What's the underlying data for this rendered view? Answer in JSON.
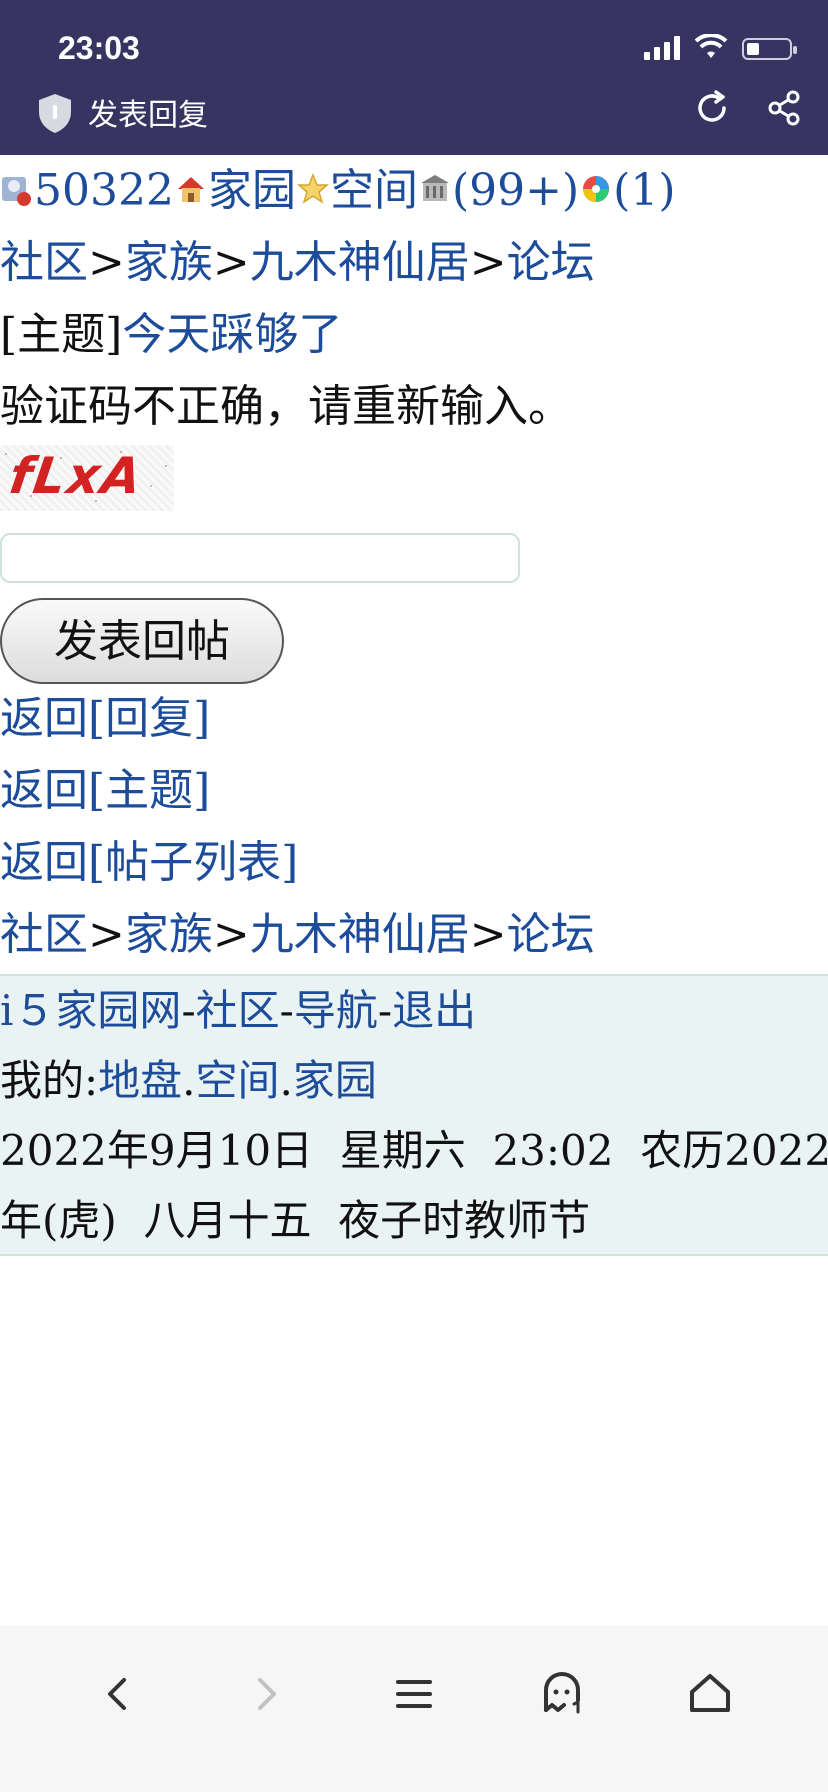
{
  "status": {
    "time": "23:03",
    "battery_level": 0.3
  },
  "topbar": {
    "title": "发表回复",
    "icons": {
      "shield": "shield-icon",
      "refresh": "refresh-icon",
      "share": "share-icon"
    }
  },
  "userbar": {
    "user_id": "50322",
    "home_label": "家园",
    "space_label": "空间",
    "msg_count": "(99+)",
    "extra_count": "(1)"
  },
  "breadcrumb": {
    "community": "社区",
    "clan": "家族",
    "group": "九木神仙居",
    "forum": "论坛",
    "sep": ">"
  },
  "topic": {
    "prefix": "[主题]",
    "title": "今天踩够了"
  },
  "error_message": "验证码不正确，请重新输入。",
  "captcha": {
    "text": "fLxA"
  },
  "form": {
    "submit_label": "发表回帖",
    "input_value": ""
  },
  "links": {
    "back_reply": "返回[回复]",
    "back_topic": "返回[主题]",
    "back_list": "返回[帖子列表]"
  },
  "footer": {
    "site": "i５家园网",
    "community": "社区",
    "nav": "导航",
    "logout": "退出",
    "dash": "-",
    "mine_prefix": "我的:",
    "mine_land": "地盘",
    "mine_space": "空间",
    "mine_home": "家园",
    "dot": ".",
    "date_line1": "2022年9月10日  星期六  23:02  农历2022",
    "date_line2": "年(虎)  八月十五  夜子时教师节"
  },
  "bottom_nav": {
    "icons": [
      "back-icon",
      "forward-icon",
      "menu-icon",
      "ghost-icon",
      "home-icon"
    ]
  },
  "colors": {
    "header_bg": "#373461",
    "link": "#1d4c9b",
    "footer_bg": "#eaf3f4"
  }
}
